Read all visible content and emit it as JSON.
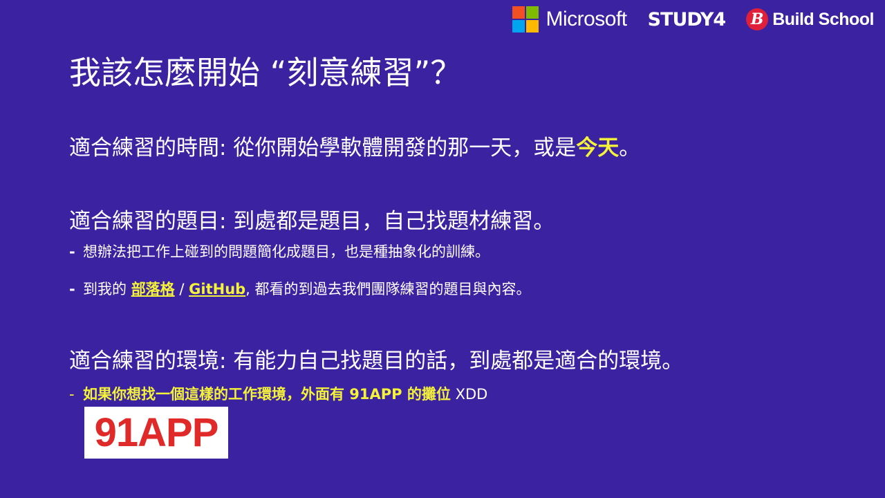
{
  "logos": {
    "microsoft": "Microsoft",
    "microsoft_colors": [
      "#f25022",
      "#7fba00",
      "#00a4ef",
      "#ffb900"
    ],
    "study4": "STUDY4",
    "build_school_mark": "B",
    "build_school": "Build School"
  },
  "title": "我該怎麼開始 “刻意練習”？",
  "time": {
    "prefix": "適合練習的時間: 從你開始學軟體開發的那一天，或是",
    "highlight": "今天",
    "suffix": "。"
  },
  "topic": {
    "text": "適合練習的題目: 到處都是題目，自己找題材練習。",
    "bullet_mark": "-",
    "bullet1": "想辦法把工作上碰到的問題簡化成題目，也是種抽象化的訓練。",
    "bullet2_prefix": "到我的",
    "blog_link": "部落格",
    "slash": "/",
    "github_link": "GitHub",
    "bullet2_suffix": ", 都看的到過去我們團隊練習的題目與內容。"
  },
  "env": {
    "text": "適合練習的環境: 有能力自己找題目的話，到處都是適合的環境。",
    "bullet_mark": "-",
    "bullet_bold": "如果你想找一個這樣的工作環境，外面有 91APP 的攤位",
    "bullet_tail": "XDD"
  },
  "logo91": "91APP",
  "colors": {
    "background": "#3a22a0",
    "highlight": "#f5f23a",
    "logo91_red": "#e02a2a"
  }
}
